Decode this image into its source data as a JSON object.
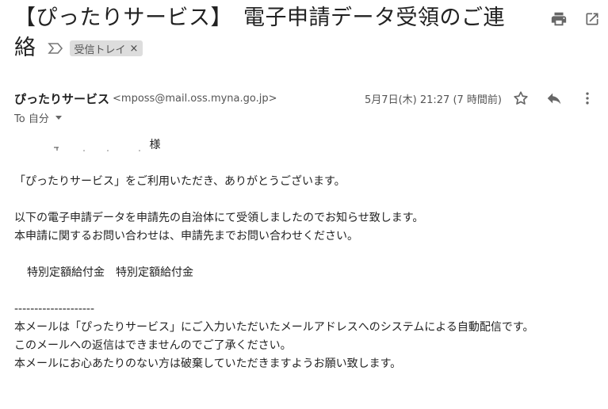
{
  "email": {
    "subject_line1": "【ぴったりサービス】　電子申請データ受領のご連",
    "subject_line2": "絡",
    "label_chip": "受信トレイ",
    "label_close": "×",
    "sender_name": "ぴったりサービス",
    "sender_email": "<mposs@mail.oss.myna.go.jp>",
    "date": "5月7日(木) 21:27 (7 時間前)",
    "to_label": "To 自分",
    "body": {
      "recipient_suffix": "様",
      "line1": "「ぴったりサービス」をご利用いただき、ありがとうございます。",
      "line2": "以下の電子申請データを申請先の自治体にて受領しましたのでお知らせ致します。",
      "line3": "本申請に関するお問い合わせは、申請先までお問い合わせください。",
      "line4": "特別定額給付金　特別定額給付金",
      "divider": "--------------------",
      "footer1": "本メールは「ぴったりサービス」にご入力いただいたメールアドレスへのシステムによる自動配信です。",
      "footer2": "このメールへの返信はできませんのでご了承ください。",
      "footer3": "本メールにお心あたりのない方は破棄していただきますようお願い致します。"
    }
  },
  "icons": {
    "print": "print-icon",
    "open_new": "open-in-new-window-icon",
    "star": "star-icon",
    "reply": "reply-icon",
    "more": "more-vert-icon",
    "important": "importance-marker-icon"
  },
  "colors": {
    "text": "#222222",
    "secondary": "#555555",
    "icon": "#666666",
    "chip_bg": "#dddddd"
  }
}
